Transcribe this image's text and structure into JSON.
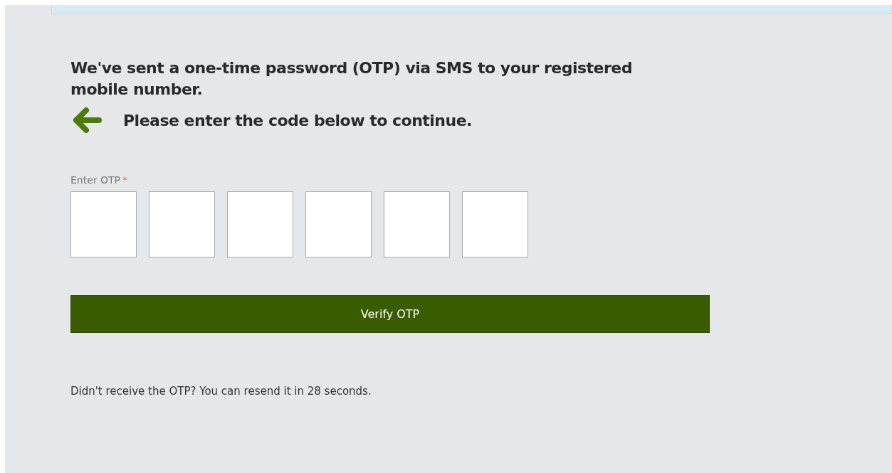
{
  "banner": {
    "visible": true
  },
  "message": "We've sent a one-time password (OTP) via SMS to your registered mobile number.",
  "instruction": "Please enter the code below to continue.",
  "otp": {
    "label": "Enter OTP",
    "required_mark": "*",
    "fields": [
      {
        "focused": false
      },
      {
        "focused": false
      },
      {
        "focused": false
      },
      {
        "focused": false
      },
      {
        "focused": false
      },
      {
        "focused": false
      }
    ]
  },
  "verify_button": "Verify OTP",
  "resend_note": "Didn't receive the OTP? You can resend it in 28 seconds."
}
